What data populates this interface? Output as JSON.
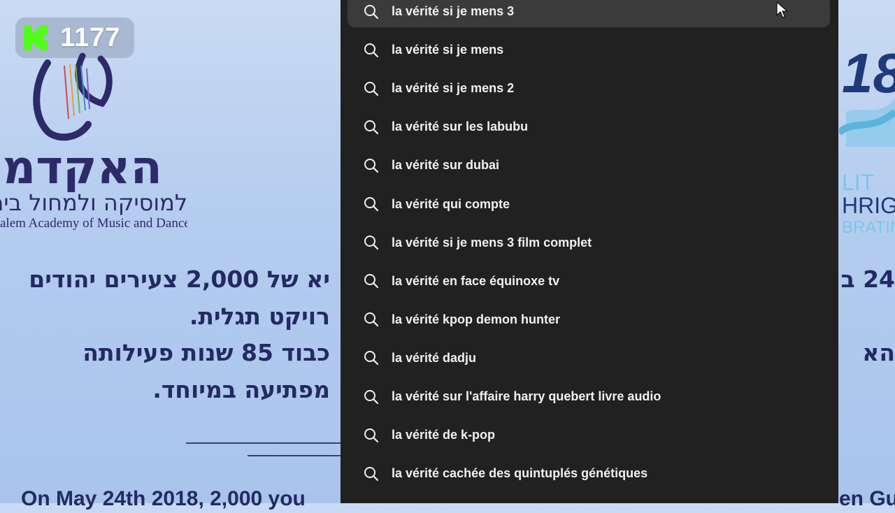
{
  "viewer_badge": {
    "count": "1177",
    "icon": "kick-logo-icon",
    "accent": "#53fc18"
  },
  "background": {
    "academy_hebrew": "האקדמיה",
    "academy_hebrew_sub": "למוסיקה ולמחול בירושלים",
    "academy_english": "alem Academy of Music and Dance",
    "hebrew_lines": [
      "יא של 2,000 צעירים יהודים",
      "רויקט תגלית.",
      "כבוד 85 שנות פעילותה",
      "מפתיעה במיוחד."
    ],
    "english_line": "On May 24th 2018, 2,000 you",
    "right_hebrew_1": "24 ב",
    "right_hebrew_2": "הא",
    "right_english": "en Gu",
    "right_logo_number": "18",
    "right_logo_lines": [
      "LIT",
      "HRIG",
      "BRATIN"
    ],
    "text_color": "#232a62"
  },
  "search_suggestions": {
    "icon": "search-icon",
    "items": [
      "la vérité si je mens 3",
      "la vérité si je mens",
      "la vérité si je mens 2",
      "la vérité sur les labubu",
      "la vérité sur dubai",
      "la vérité qui compte",
      "la vérité si je mens 3 film complet",
      "la vérité en face équinoxe tv",
      "la vérité kpop demon hunter",
      "la vérité dadju",
      "la vérité sur l'affaire harry quebert livre audio",
      "la vérité de k-pop",
      "la vérité cachée des quintuplés génétiques"
    ],
    "highlighted_index": 0,
    "panel_color": "#212121",
    "highlight_color": "#3b3b3b"
  },
  "pointer": {
    "icon": "mouse-cursor-icon"
  }
}
